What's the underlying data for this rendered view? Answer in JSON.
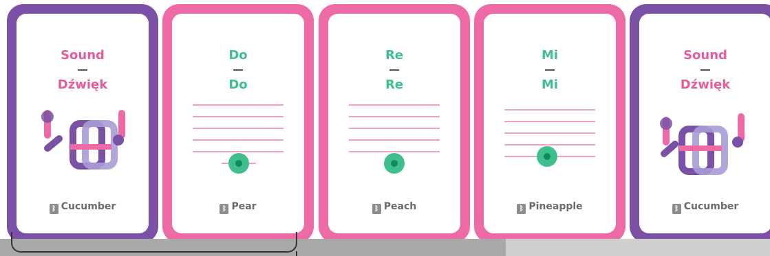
{
  "cards": [
    {
      "title_en": "Sound",
      "title_pl": "Dźwięk",
      "sensor": "Cucumber",
      "icon": "sound-icon",
      "frame_color": "#7b51a6"
    },
    {
      "title_en": "Do",
      "title_pl": "Do",
      "sensor": "Pear",
      "icon": "music-staff-note-icon",
      "frame_color": "#ee6aa7"
    },
    {
      "title_en": "Re",
      "title_pl": "Re",
      "sensor": "Peach",
      "icon": "music-staff-note-icon",
      "frame_color": "#ee6aa7"
    },
    {
      "title_en": "Mi",
      "title_pl": "Mi",
      "sensor": "Pineapple",
      "icon": "music-staff-note-icon",
      "frame_color": "#ee6aa7"
    },
    {
      "title_en": "Sound",
      "title_pl": "Dźwięk",
      "sensor": "Cucumber",
      "icon": "sound-icon",
      "frame_color": "#7b51a6"
    }
  ],
  "colors": {
    "purple": "#7b51a6",
    "pink": "#ee6aa7",
    "green_note": "#3fbf8e",
    "staff_line": "#f2a0c0"
  }
}
